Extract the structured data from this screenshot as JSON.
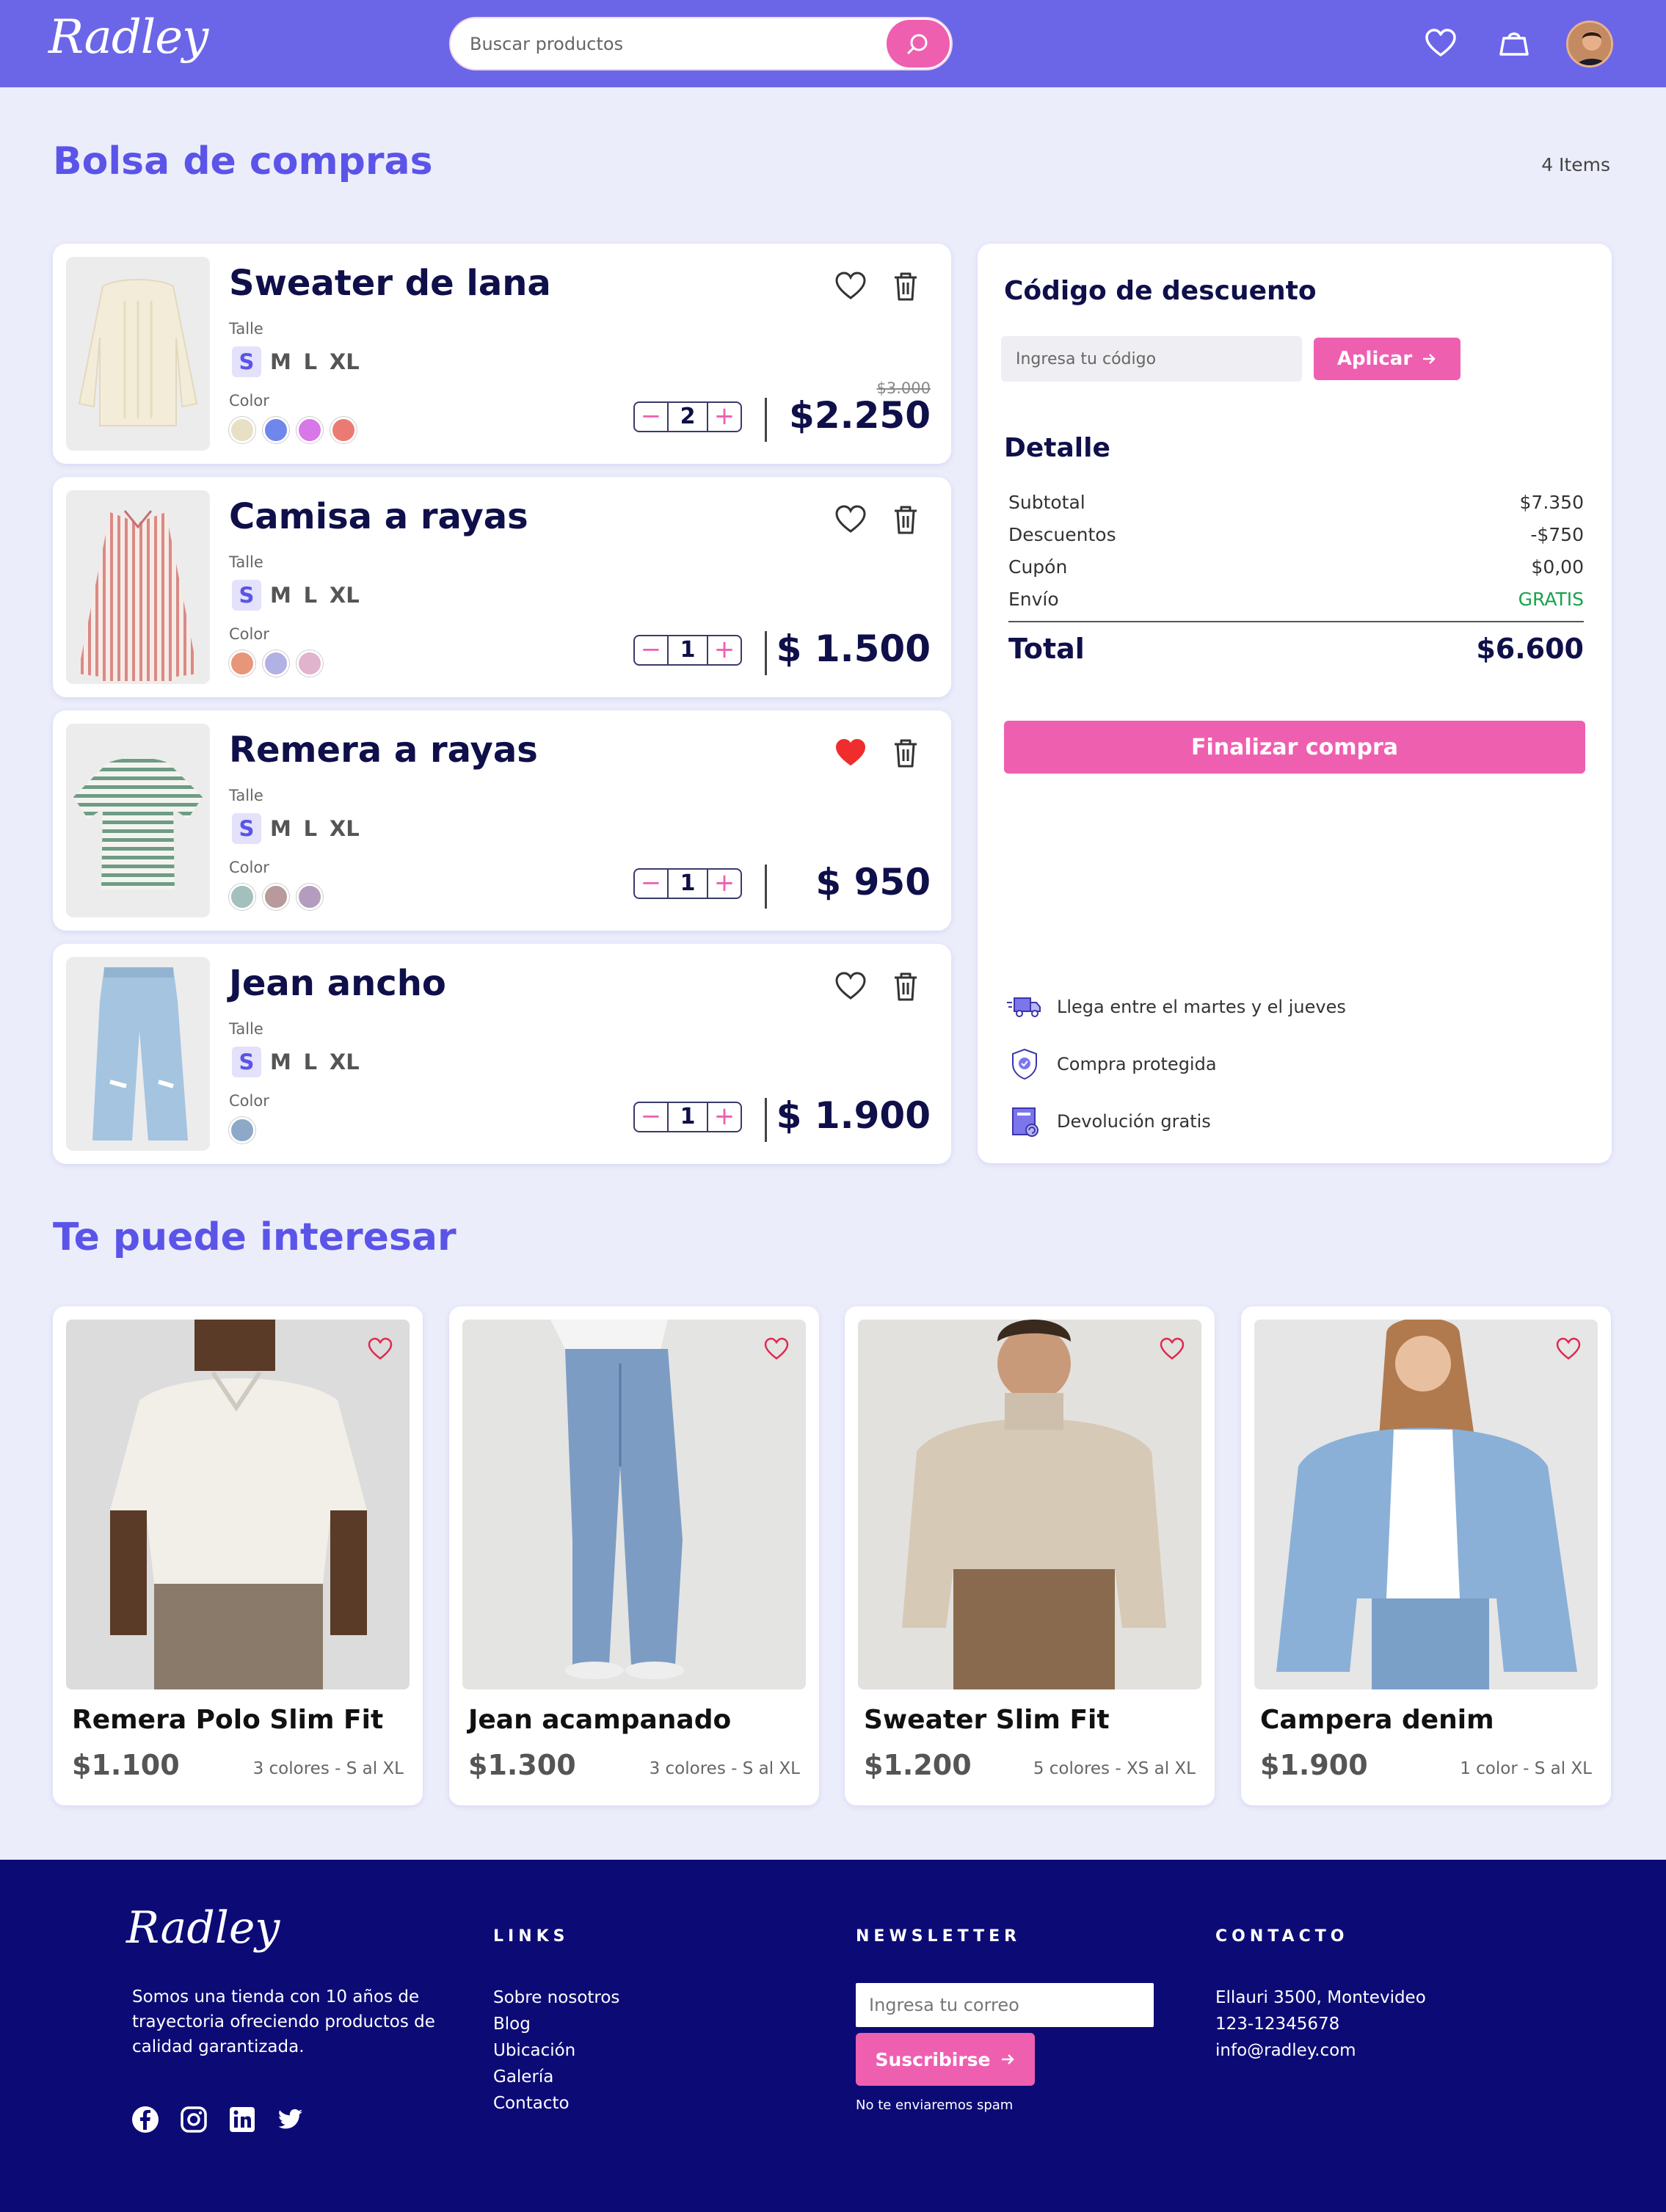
{
  "header": {
    "logo": "Radley",
    "search_placeholder": "Buscar productos"
  },
  "cart": {
    "title": "Bolsa de compras",
    "items_count": "4 Items",
    "size_label": "Talle",
    "color_label": "Color",
    "sizes": [
      "S",
      "M",
      "L",
      "XL"
    ],
    "items": [
      {
        "name": "Sweater de lana",
        "selected_size": "S",
        "colors": [
          "#e8e0c4",
          "#6f87ec",
          "#d877e8",
          "#ec7a74"
        ],
        "quantity": "2",
        "old_price": "$3.000",
        "price": "$2.250",
        "favorite": false
      },
      {
        "name": "Camisa a rayas",
        "selected_size": "S",
        "colors": [
          "#e8967a",
          "#b2b1e4",
          "#dfb4cc"
        ],
        "quantity": "1",
        "old_price": "",
        "price": "$ 1.500",
        "favorite": false
      },
      {
        "name": "Remera a rayas",
        "selected_size": "S",
        "colors": [
          "#a3c0bd",
          "#b89a9c",
          "#b49cbf"
        ],
        "quantity": "1",
        "old_price": "",
        "price": "$ 950",
        "favorite": true
      },
      {
        "name": "Jean ancho",
        "selected_size": "S",
        "colors": [
          "#8ea8c8"
        ],
        "quantity": "1",
        "old_price": "",
        "price": "$ 1.900",
        "favorite": false
      }
    ]
  },
  "summary": {
    "discount_title": "Código de descuento",
    "code_placeholder": "Ingresa tu código",
    "apply_label": "Aplicar",
    "detail_title": "Detalle",
    "rows": [
      {
        "label": "Subtotal",
        "value": "$7.350"
      },
      {
        "label": "Descuentos",
        "value": "-$750"
      },
      {
        "label": "Cupón",
        "value": "$0,00"
      },
      {
        "label": "Envío",
        "value": "GRATIS"
      }
    ],
    "total_label": "Total",
    "total_value": "$6.600",
    "checkout_label": "Finalizar compra",
    "benefits": [
      {
        "icon": "truck-icon",
        "text": "Llega entre el martes y el jueves"
      },
      {
        "icon": "shield-icon",
        "text": "Compra protegida"
      },
      {
        "icon": "return-icon",
        "text": "Devolución gratis"
      }
    ]
  },
  "recommended": {
    "title": "Te puede interesar",
    "products": [
      {
        "name": "Remera Polo Slim Fit",
        "price": "$1.100",
        "meta": "3 colores - S al XL"
      },
      {
        "name": "Jean acampanado",
        "price": "$1.300",
        "meta": "3 colores - S al XL"
      },
      {
        "name": "Sweater Slim Fit",
        "price": "$1.200",
        "meta": "5 colores - XS al XL"
      },
      {
        "name": "Campera denim",
        "price": "$1.900",
        "meta": "1 color - S al XL"
      }
    ]
  },
  "footer": {
    "logo": "Radley",
    "about": "Somos una tienda con 10 años de trayectoria ofreciendo productos de calidad garantizada.",
    "links_title": "LINKS",
    "links": [
      "Sobre nosotros",
      "Blog",
      "Ubicación",
      "Galería",
      "Contacto"
    ],
    "newsletter_title": "NEWSLETTER",
    "email_placeholder": "Ingresa tu correo",
    "subscribe_label": "Suscribirse",
    "spam_note": "No te enviaremos spam",
    "contact_title": "CONTACTO",
    "contact": [
      "Ellauri 3500, Montevideo",
      "123-12345678",
      "info@radley.com"
    ]
  },
  "colors": {
    "header": "#6b66e8",
    "accent": "#ef5fb0",
    "title": "#5b54e8",
    "footer": "#0c0b76",
    "background": "#ecedfb"
  }
}
